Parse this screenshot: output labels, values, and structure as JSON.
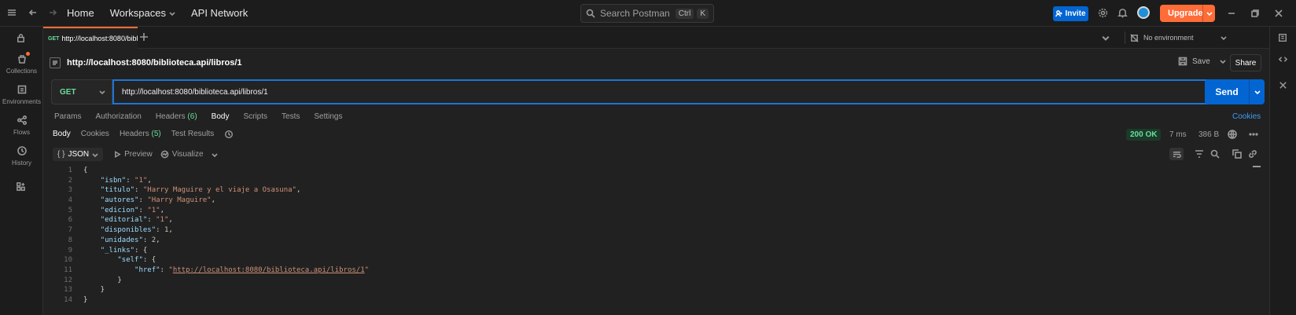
{
  "topbar": {
    "nav": [
      "Home",
      "Workspaces",
      "API Network"
    ],
    "search_placeholder": "Search Postman",
    "search_kbd": [
      "Ctrl",
      "K"
    ],
    "invite_label": "Invite",
    "upgrade_label": "Upgrade"
  },
  "sidebar": {
    "items": [
      {
        "label": "Collections",
        "icon": "collections-icon"
      },
      {
        "label": "Environments",
        "icon": "environments-icon"
      },
      {
        "label": "Flows",
        "icon": "flows-icon"
      },
      {
        "label": "History",
        "icon": "history-icon"
      }
    ]
  },
  "tabs": {
    "active": {
      "method": "GET",
      "title": "http://localhost:8080/bibl"
    },
    "environment": "No environment"
  },
  "request": {
    "breadcrumb": "http://localhost:8080/biblioteca.api/libros/1",
    "save_label": "Save",
    "share_label": "Share",
    "method": "GET",
    "url": "http://localhost:8080/biblioteca.api/libros/1",
    "send_label": "Send",
    "subtabs": [
      "Params",
      "Authorization",
      "Headers",
      "Body",
      "Scripts",
      "Tests",
      "Settings"
    ],
    "headers_count": "(6)",
    "cookies_label": "Cookies"
  },
  "response": {
    "tabs": [
      "Body",
      "Cookies",
      "Headers",
      "Test Results"
    ],
    "headers_count": "(5)",
    "status": "200 OK",
    "time": "7 ms",
    "size": "386 B",
    "format": "JSON",
    "preview_label": "Preview",
    "visualize_label": "Visualize"
  },
  "colors": {
    "accent": "#ff6c37",
    "primary": "#0265d2",
    "success": "#6bdd9a"
  }
}
